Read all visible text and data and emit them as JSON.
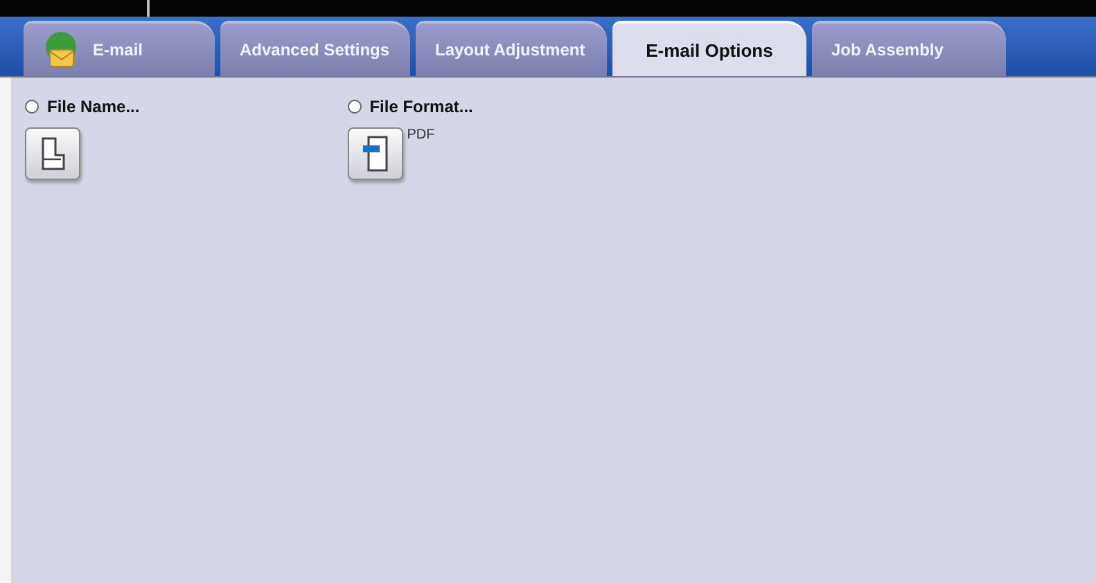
{
  "tabs": [
    {
      "label": "E-mail",
      "kind": "home",
      "selected": false
    },
    {
      "label": "Advanced Settings",
      "kind": "plain",
      "selected": false
    },
    {
      "label": "Layout Adjustment",
      "kind": "plain",
      "selected": false
    },
    {
      "label": "E-mail Options",
      "kind": "plain",
      "selected": true
    },
    {
      "label": "Job Assembly",
      "kind": "plain",
      "selected": false
    }
  ],
  "options": [
    {
      "label": "File Name...",
      "kind": "name",
      "selected": false
    },
    {
      "label": "File Format...",
      "kind": "format",
      "selected": false,
      "value": "PDF"
    }
  ]
}
